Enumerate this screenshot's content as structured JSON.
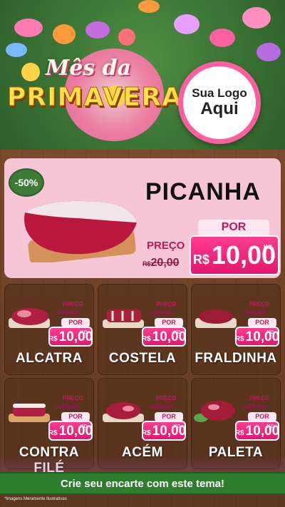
{
  "header": {
    "title_top": "Mês da",
    "title_bottom": "PRIMAVERA",
    "logo_line1": "Sua Logo",
    "logo_line2": "Aqui"
  },
  "featured": {
    "discount": "-50%",
    "name": "PICANHA",
    "preco_label": "PREÇO",
    "old_currency": "R$",
    "old_price": "20,00",
    "por_label": "POR",
    "new_currency": "R$",
    "new_price": "10,00",
    "unit": "KG"
  },
  "products": [
    {
      "name": "ALCATRA",
      "preco_label": "PREÇO",
      "old_currency": "R$",
      "old_price": "20,00",
      "por_label": "POR",
      "new_currency": "R$",
      "new_price": "10,00",
      "unit": "KG"
    },
    {
      "name": "COSTELA",
      "preco_label": "PREÇO",
      "old_currency": "R$",
      "old_price": "20,00",
      "por_label": "POR",
      "new_currency": "R$",
      "new_price": "10,00",
      "unit": "KG"
    },
    {
      "name": "FRALDINHA",
      "preco_label": "PREÇO",
      "old_currency": "R$",
      "old_price": "20,00",
      "por_label": "POR",
      "new_currency": "R$",
      "new_price": "10,00",
      "unit": "KG"
    },
    {
      "name": "CONTRA FILÉ",
      "preco_label": "PREÇO",
      "old_currency": "R$",
      "old_price": "20,00",
      "por_label": "POR",
      "new_currency": "R$",
      "new_price": "10,00",
      "unit": "KG"
    },
    {
      "name": "ACÉM",
      "preco_label": "PREÇO",
      "old_currency": "R$",
      "old_price": "20,00",
      "por_label": "POR",
      "new_currency": "R$",
      "new_price": "10,00",
      "unit": "KG"
    },
    {
      "name": "PALETA",
      "preco_label": "PREÇO",
      "old_currency": "R$",
      "old_price": "20,00",
      "por_label": "POR",
      "new_currency": "R$",
      "new_price": "10,00",
      "unit": "KG"
    }
  ],
  "footer": {
    "cta": "Crie seu encarte com este tema!",
    "disclaimer": "*Imagens Meramente Ilustrativas"
  },
  "colors": {
    "green": "#3a7335",
    "pink": "#e0186f",
    "wood": "#6e4127",
    "yellow_title": "#ffe14a"
  }
}
